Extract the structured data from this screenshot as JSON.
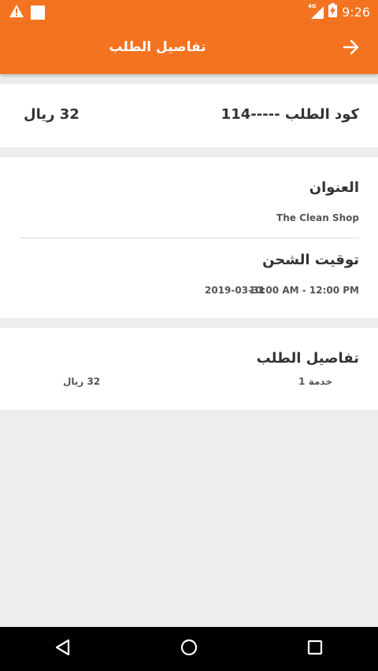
{
  "status_bar": {
    "time": "9:26",
    "network": "4G",
    "icons": [
      "warning-icon",
      "notification-square-icon",
      "signal-icon",
      "battery-icon"
    ]
  },
  "app_bar": {
    "title": "تفاصيل الطلب",
    "back_icon": "arrow-right-icon",
    "color": "#f47320"
  },
  "order_summary": {
    "code_label": "كود الطلب -----114",
    "price": "32 ريال"
  },
  "address_section": {
    "address_label": "العنوان",
    "address_value": "The Clean Shop",
    "shipping_label": "توقيت الشحن",
    "shipping_time": "10:00 AM - 12:00 PM",
    "shipping_date": "2019-03-31"
  },
  "details_section": {
    "title": "تفاصيل الطلب",
    "item_name": "خدمة 1",
    "item_price": "32 ريال"
  },
  "nav_bar": {
    "icons": [
      "back-triangle-icon",
      "home-circle-icon",
      "recents-square-icon"
    ]
  }
}
